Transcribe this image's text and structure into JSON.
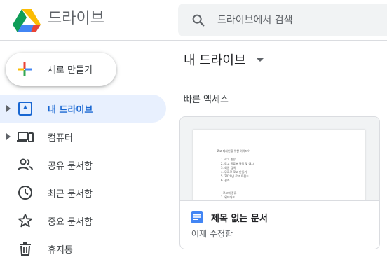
{
  "header": {
    "app_title": "드라이브",
    "search_placeholder": "드라이브에서 검색",
    "logo_icon": "google-drive-logo"
  },
  "sidebar": {
    "new_button_label": "새로 만들기",
    "items": [
      {
        "label": "내 드라이브",
        "icon": "my-drive-icon",
        "active": true,
        "expandable": true
      },
      {
        "label": "컴퓨터",
        "icon": "computers-icon",
        "active": false,
        "expandable": true
      },
      {
        "label": "공유 문서함",
        "icon": "shared-people-icon",
        "active": false,
        "expandable": false
      },
      {
        "label": "최근 문서함",
        "icon": "clock-icon",
        "active": false,
        "expandable": false
      },
      {
        "label": "중요 문서함",
        "icon": "star-icon",
        "active": false,
        "expandable": false
      },
      {
        "label": "휴지통",
        "icon": "trash-icon",
        "active": false,
        "expandable": false
      }
    ]
  },
  "main": {
    "title": "내 드라이브",
    "quick_access_label": "빠른 액세스",
    "card": {
      "name": "제목 없는 문서",
      "subtitle": "어제 수정함",
      "preview_title": "로고 디자인을 위한 아이디어",
      "preview_items": [
        "1.   로고 종류",
        "2.   로고 종류별 특징 및 예시",
        "3.   회원 검색",
        "4.   무료로 로고 만들기",
        "5.   2020년 로고 트렌드",
        "6.   결과"
      ],
      "preview_items_2": [
        "-   로고의 종류",
        "1.   워드마크"
      ]
    }
  },
  "colors": {
    "accent_blue": "#1a73e8",
    "active_bg": "#e8f0fe",
    "active_text": "#1967d2",
    "search_bg": "#f1f3f4",
    "icon_gray": "#5f6368"
  }
}
